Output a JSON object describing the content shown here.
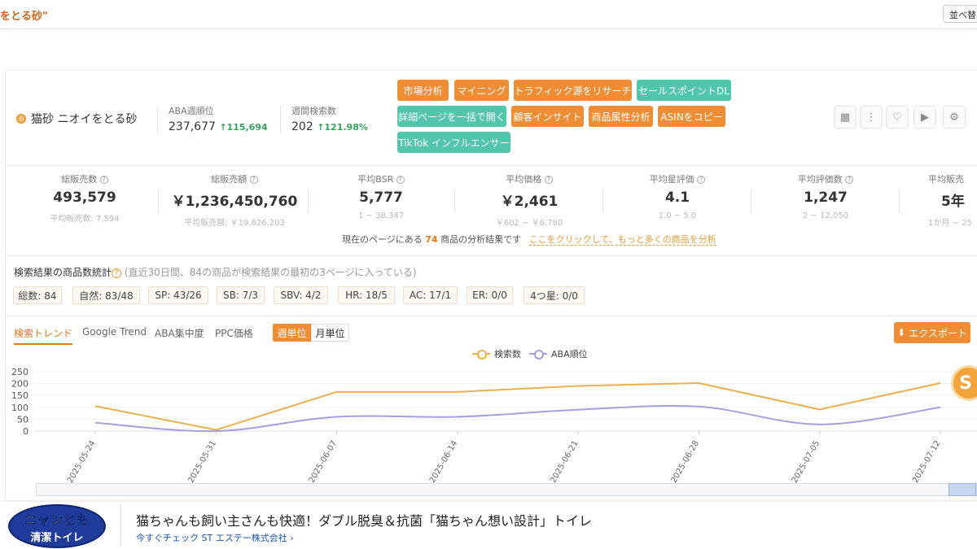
{
  "topbar": {
    "title": "をとる砂\"",
    "sort_button": "並べ替え"
  },
  "keyword": {
    "label": "猫砂 ニオイをとる砂"
  },
  "aba_rank": {
    "label": "ABA週順位",
    "value": "237,677",
    "change": "115,694"
  },
  "weekly_search": {
    "label": "週間検索数",
    "value": "202",
    "change": "121.98%"
  },
  "actions": [
    {
      "label": "市場分析",
      "color": "#ef8d35"
    },
    {
      "label": "マイニング",
      "color": "#ef8d35"
    },
    {
      "label": "トラフィック源をリサーチ",
      "color": "#ef8d35"
    },
    {
      "label": "セールスポイントDL",
      "color": "#52c6ad"
    },
    {
      "label": "詳細ページを一括で開く",
      "color": "#52c6ad"
    },
    {
      "label": "顧客インサイト",
      "color": "#ef8d35"
    },
    {
      "label": "商品属性分析",
      "color": "#ef8d35"
    },
    {
      "label": "ASINをコピー",
      "color": "#ef8d35"
    },
    {
      "label": "TikTok インフルエンサー",
      "color": "#52c6ad"
    }
  ],
  "toolbar_icons": [
    "grid-icon",
    "more-vertical-icon",
    "heart-icon",
    "video-icon",
    "settings-icon"
  ],
  "stats": [
    {
      "label": "総販売数",
      "value": "493,579",
      "sub": "平均販売数: 7,594"
    },
    {
      "label": "総販売額",
      "value": "￥1,236,450,760",
      "sub": "平均販売額: ￥19,626,203"
    },
    {
      "label": "平均BSR",
      "value": "5,777",
      "sub": "1 ~ 38,347"
    },
    {
      "label": "平均価格",
      "value": "￥2,461",
      "sub": "￥602 ~ ￥6,780"
    },
    {
      "label": "平均星評価",
      "value": "4.1",
      "sub": "1.0 ~ 5.0"
    },
    {
      "label": "平均評価数",
      "value": "1,247",
      "sub": "2 ~ 12,050"
    },
    {
      "label": "平均販売",
      "value": "5年",
      "sub": "1か月 ~ 25"
    }
  ],
  "page_info": {
    "prefix": "現在のページにある",
    "count": "74",
    "suffix": "商品の分析結果です",
    "link": "ここをクリックして、もっと多くの商品を分析"
  },
  "search_stats": {
    "title": "検索結果の商品数統計",
    "note": "(直近30日間、84の商品が検索結果の最初の3ページに入っている)",
    "chips": [
      "総数: 84",
      "自然: 83/48",
      "SP: 43/26",
      "SB: 7/3",
      "SBV: 4/2",
      "HR: 18/5",
      "AC: 17/1",
      "ER: 0/0",
      "4つ星: 0/0"
    ]
  },
  "tabs": [
    "検索トレンド",
    "Google Trend",
    "ABA集中度",
    "PPC価格"
  ],
  "period": {
    "weekly": "週単位",
    "monthly": "月単位"
  },
  "export_label": "エクスポート",
  "chart_data": {
    "type": "line",
    "x": [
      "2025-05-24",
      "2025-05-31",
      "2025-06-07",
      "2025-06-14",
      "2025-06-21",
      "2025-06-28",
      "2025-07-05",
      "2025-07-12"
    ],
    "series": [
      {
        "name": "検索数",
        "values": [
          105,
          5,
          165,
          165,
          190,
          202,
          91,
          202
        ],
        "color": "#e8b04f",
        "smooth": false
      },
      {
        "name": "ABA順位",
        "values": [
          35,
          0,
          60,
          60,
          90,
          103,
          28,
          100
        ],
        "color": "#a3a0e0",
        "smooth": true
      }
    ],
    "yticks": [
      0,
      50,
      100,
      150,
      200,
      250
    ],
    "ylim": [
      0,
      250
    ],
    "grid": true,
    "legend": "top-center"
  },
  "ad": {
    "logo_line1": "ニャンとも",
    "logo_line2": "清潔トイレ",
    "headline": "猫ちゃんも飼い主さんも快適！ダブル脱臭＆抗菌「猫ちゃん想い設計」トイレ",
    "sub": "今すぐチェック ST エステー株式会社 ›"
  }
}
